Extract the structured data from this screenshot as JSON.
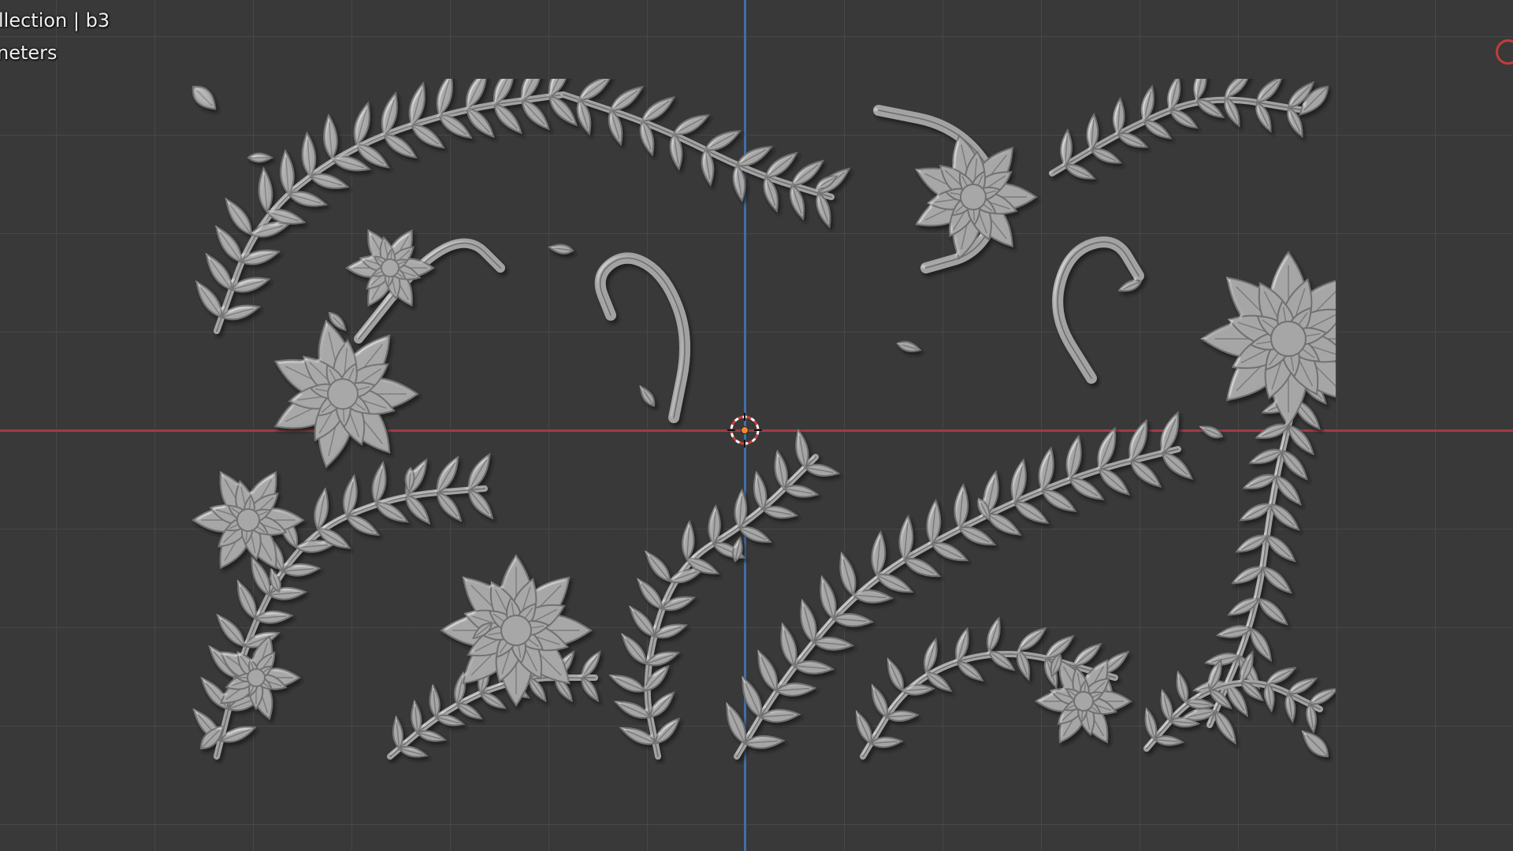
{
  "overlay": {
    "line1": "llection | b3",
    "line2": "neters"
  },
  "colors": {
    "viewport_background": "#393939",
    "grid_line": "#484848",
    "x_axis": "#a23b45",
    "y_axis": "#3f6fa8",
    "relief": "#a7a7a7"
  },
  "icons": {
    "origin": "3d-cursor-icon",
    "edge_marker": "navigation-gizmo-icon"
  }
}
